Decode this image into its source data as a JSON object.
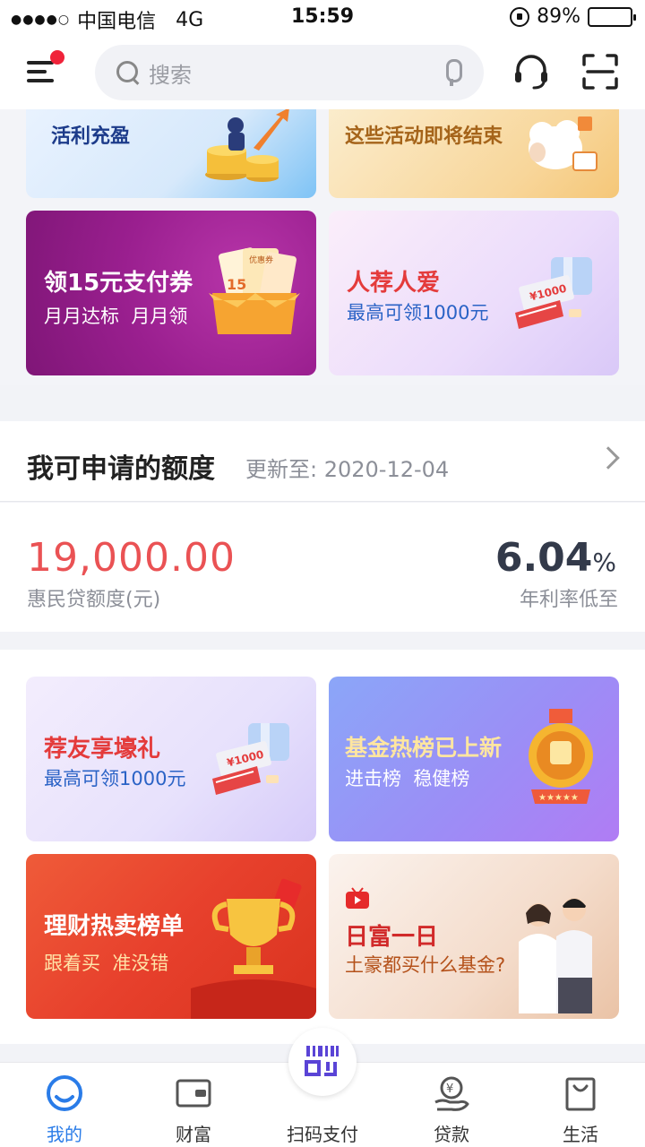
{
  "status_bar": {
    "signal": "●●●●○",
    "carrier": "中国电信",
    "network": "4G",
    "time": "15:59",
    "battery": "89%",
    "battery_level": 0.89
  },
  "header": {
    "search_placeholder": "搜索"
  },
  "top_banners": [
    {
      "subtitle": "活利充盈"
    },
    {
      "subtitle": "这些活动即将结束"
    }
  ],
  "promo_row1": [
    {
      "title": "领15元支付券",
      "subtitle": "月月达标  月月领",
      "badge": "优惠券",
      "badge_num": "15"
    },
    {
      "title": "人荐人爱",
      "subtitle": "最高可领1000元",
      "ticket": "¥1000"
    }
  ],
  "credit": {
    "title": "我可申请的额度",
    "update_label": "更新至: 2020-12-04",
    "amount": "19,000.00",
    "amount_label": "惠民贷额度(元)",
    "rate": "6.04",
    "rate_unit": "%",
    "rate_label": "年利率低至"
  },
  "promo_grid": [
    {
      "title": "荐友享壕礼",
      "subtitle": "最高可领1000元",
      "ticket": "¥1000"
    },
    {
      "title": "基金热榜已上新",
      "subtitle": "进击榜  稳健榜"
    },
    {
      "title": "理财热卖榜单",
      "subtitle": "跟着买  准没错"
    },
    {
      "title": "日富一日",
      "subtitle": "土豪都买什么基金?"
    }
  ],
  "tabs": [
    {
      "label": "我的",
      "icon": "smile-icon",
      "active": true
    },
    {
      "label": "财富",
      "icon": "wallet-icon",
      "active": false
    },
    {
      "label": "扫码支付",
      "icon": "qr-pay-icon",
      "active": false
    },
    {
      "label": "贷款",
      "icon": "yen-hand-icon",
      "active": false
    },
    {
      "label": "生活",
      "icon": "shopping-bag-icon",
      "active": false
    }
  ],
  "colors": {
    "accent": "#2a7ce8",
    "amount_red": "#ea5254",
    "notification_dot": "#f0233a"
  }
}
